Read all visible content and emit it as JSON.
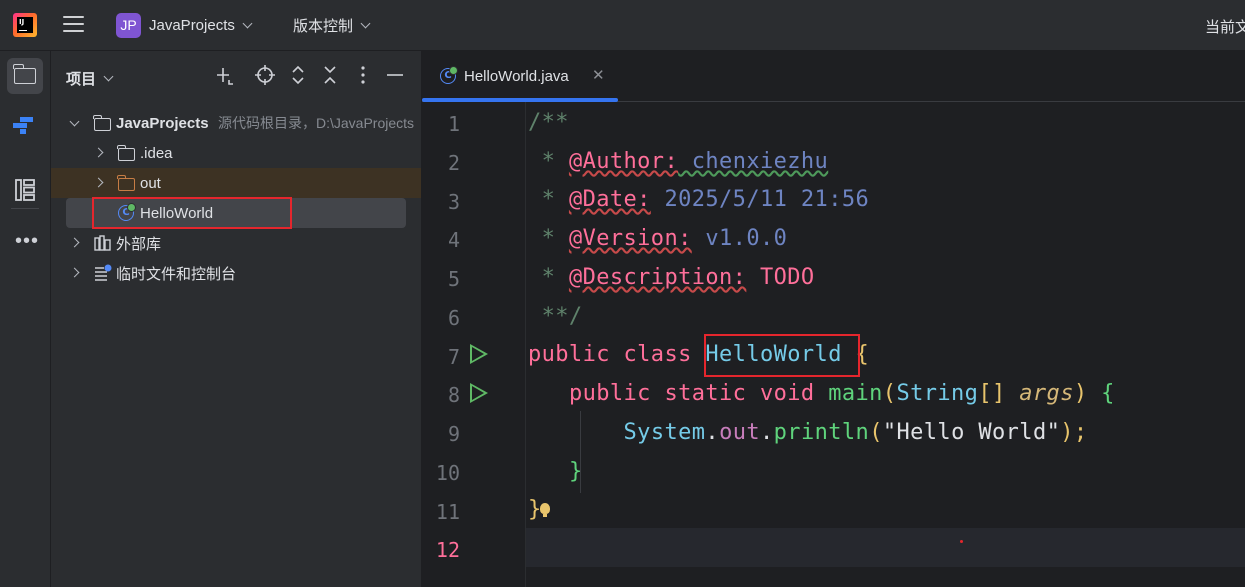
{
  "titlebar": {
    "project_initials": "JP",
    "project_name": "JavaProjects",
    "vcs_label": "版本控制",
    "current_file_label": "当前文"
  },
  "project_panel": {
    "title": "项目",
    "tree": [
      {
        "label": "JavaProjects",
        "hint": "源代码根目录，D:\\JavaProjects"
      },
      {
        "label": ".idea"
      },
      {
        "label": "out"
      },
      {
        "label": "HelloWorld"
      },
      {
        "label": "外部库"
      },
      {
        "label": "临时文件和控制台"
      }
    ]
  },
  "editor": {
    "tab_label": "HelloWorld.java",
    "line_numbers": [
      "1",
      "2",
      "3",
      "4",
      "5",
      "6",
      "7",
      "8",
      "9",
      "10",
      "11",
      "12"
    ],
    "code": {
      "l1": "/**",
      "l2_prefix": " * ",
      "l2_tag": "@Author:",
      "l2_value": " chenxiezhu",
      "l3_prefix": " * ",
      "l3_tag": "@Date:",
      "l3_value": " 2025/5/11 21:56",
      "l4_prefix": " * ",
      "l4_tag": "@Version:",
      "l4_value": " v1.0.0",
      "l5_prefix": " * ",
      "l5_tag": "@Description:",
      "l5_value": " TODO",
      "l6": " **/",
      "l7_kw": "public class ",
      "l7_cls": "HelloWorld",
      "l7_brace": " {",
      "l8_indent": "   ",
      "l8_kw": "public static void ",
      "l8_fn": "main",
      "l8_p1": "(",
      "l8_type": "String",
      "l8_arr": "[] ",
      "l8_param": "args",
      "l8_p2": ") ",
      "l8_brace": "{",
      "l9_indent": "       ",
      "l9_cls": "System",
      "l9_dot1": ".",
      "l9_field": "out",
      "l9_dot2": ".",
      "l9_fn": "println",
      "l9_p1": "(",
      "l9_str": "\"Hello World\"",
      "l9_p2": ");",
      "l10_indent": "   ",
      "l10_brace": "}",
      "l11_brace": "}"
    }
  }
}
